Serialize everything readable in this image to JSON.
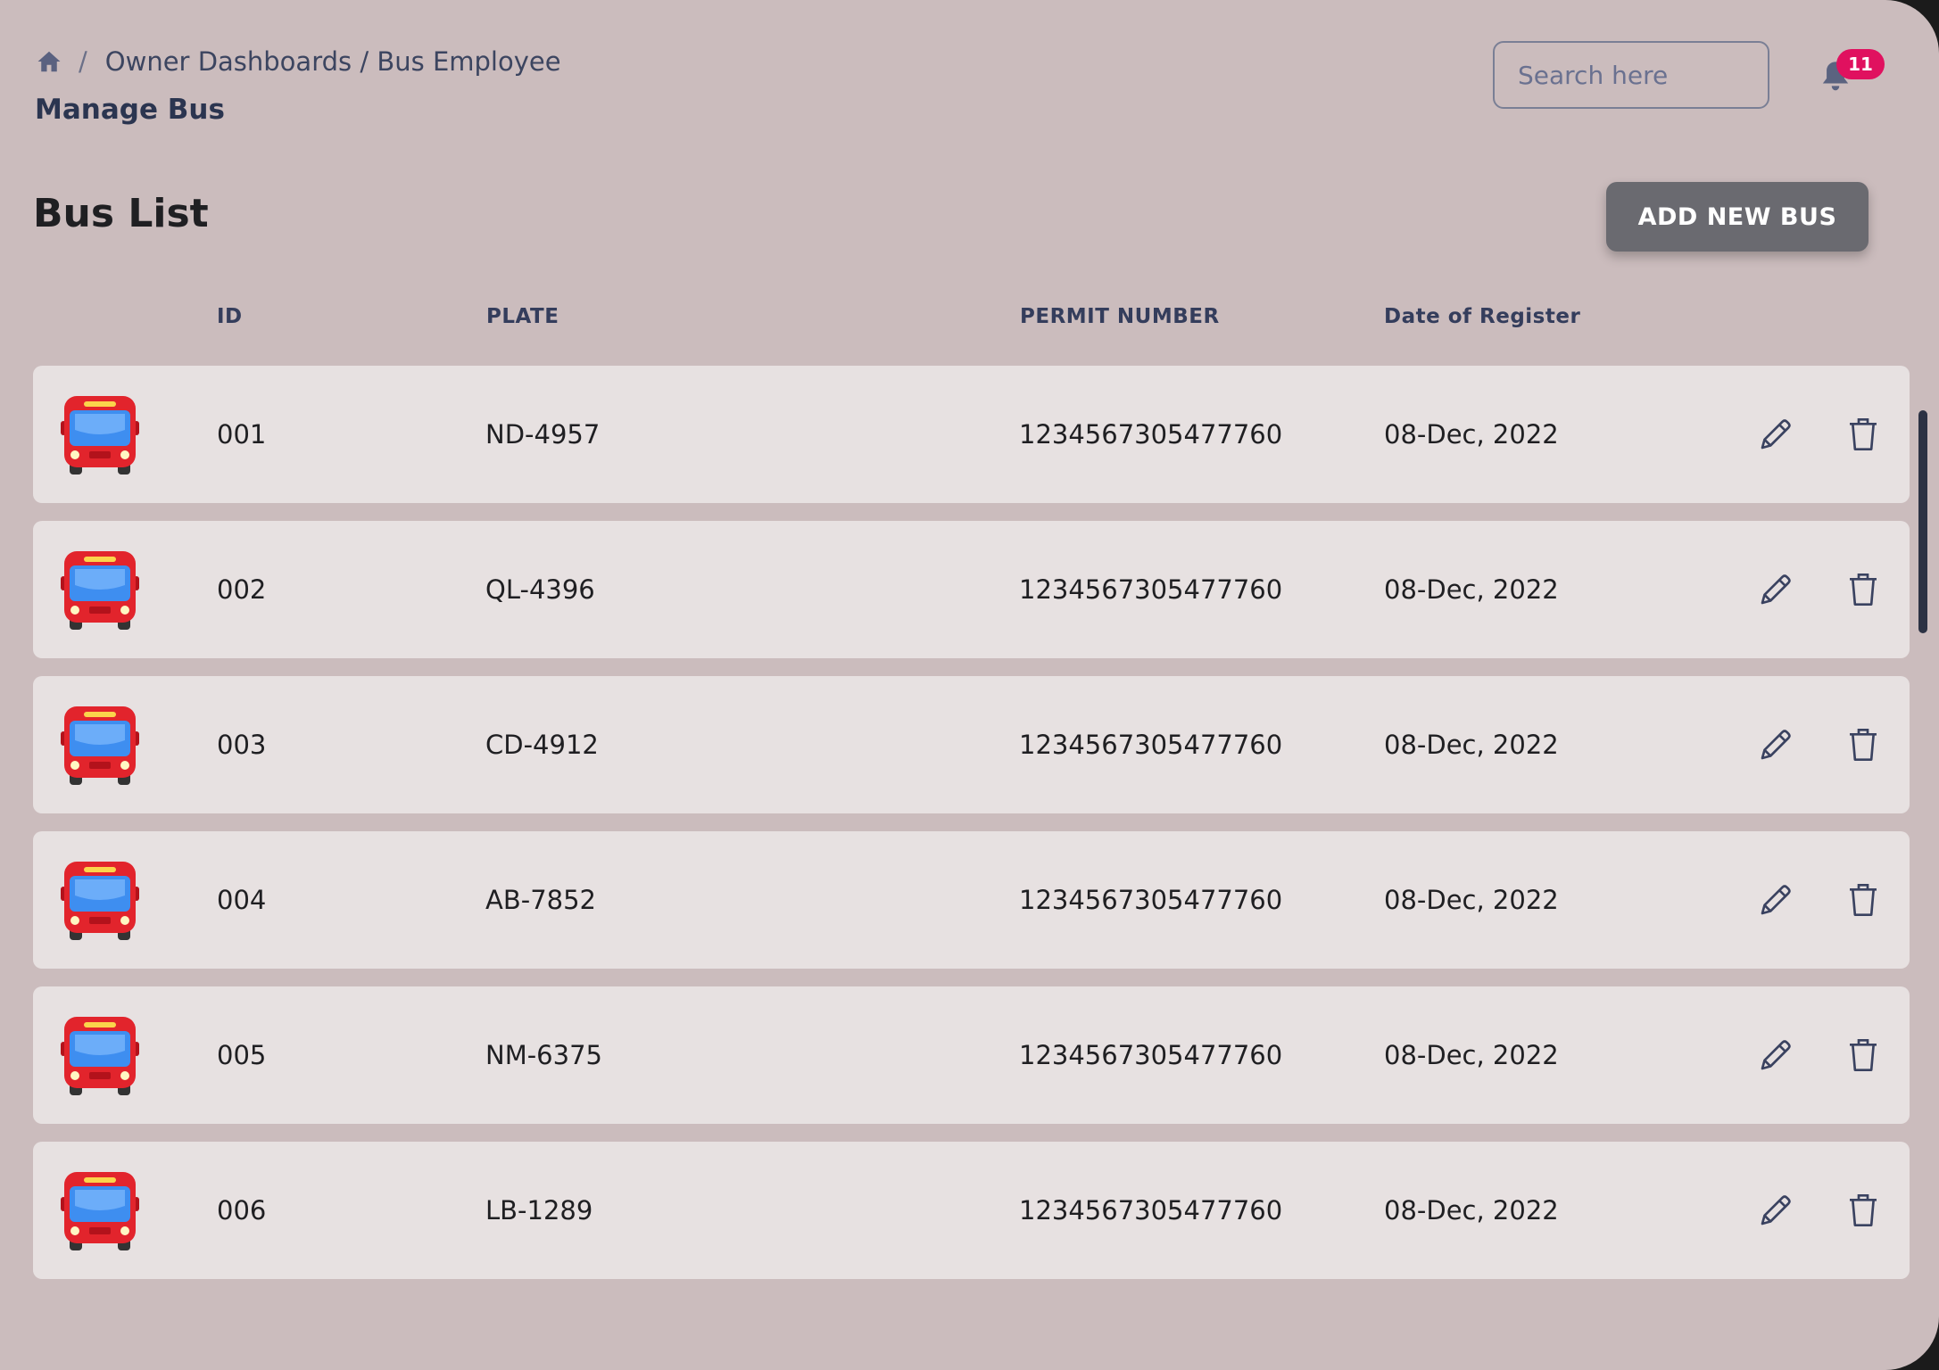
{
  "breadcrumb": {
    "path": "Owner Dashboards / Bus Employee",
    "separator": "/"
  },
  "page": {
    "title": "Manage Bus"
  },
  "search": {
    "placeholder": "Search here"
  },
  "notifications": {
    "count": "11"
  },
  "list": {
    "title": "Bus List",
    "add_button_label": "ADD NEW BUS",
    "columns": {
      "id": "ID",
      "plate": "PLATE",
      "permit": "PERMIT NUMBER",
      "date": "Date of Register"
    },
    "rows": [
      {
        "id": "001",
        "plate": "ND-4957",
        "permit": "1234567305477760",
        "date": "08-Dec, 2022"
      },
      {
        "id": "002",
        "plate": "QL-4396",
        "permit": "1234567305477760",
        "date": "08-Dec, 2022"
      },
      {
        "id": "003",
        "plate": "CD-4912",
        "permit": "1234567305477760",
        "date": "08-Dec, 2022"
      },
      {
        "id": "004",
        "plate": "AB-7852",
        "permit": "1234567305477760",
        "date": "08-Dec, 2022"
      },
      {
        "id": "005",
        "plate": "NM-6375",
        "permit": "1234567305477760",
        "date": "08-Dec, 2022"
      },
      {
        "id": "006",
        "plate": "LB-1289",
        "permit": "1234567305477760",
        "date": "08-Dec, 2022"
      }
    ]
  },
  "icons": {
    "home": "home-icon",
    "bell": "bell-icon",
    "bus": "bus-icon",
    "edit": "pencil-icon",
    "delete": "trash-icon"
  },
  "colors": {
    "background": "#cbbcbd",
    "row_background": "#e7e1e1",
    "badge": "#e0115f",
    "button": "#6a6a70",
    "heading_text": "#2b3550"
  }
}
